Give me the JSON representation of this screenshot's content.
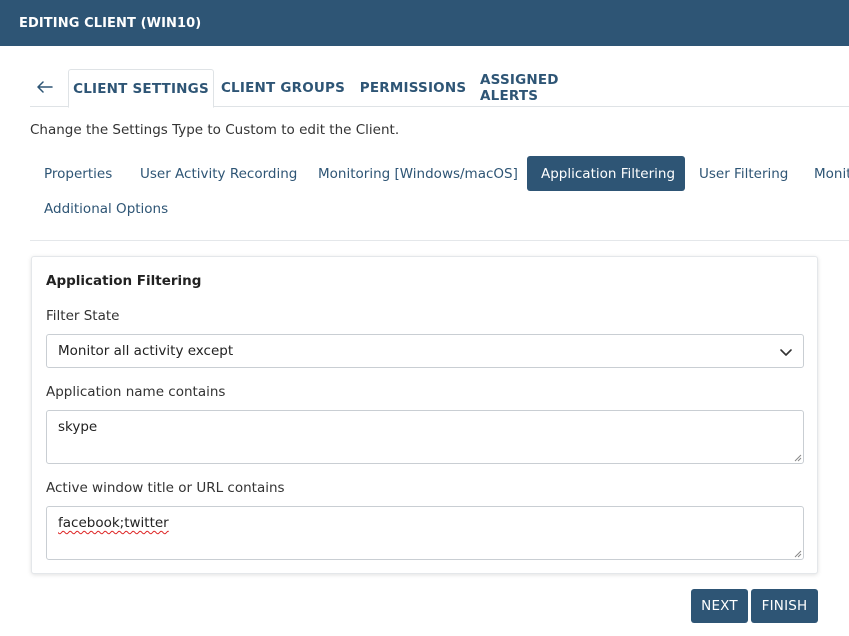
{
  "window": {
    "title": "EDITING CLIENT (WIN10)"
  },
  "tabs": {
    "back_icon": "arrow-left-icon",
    "items": [
      {
        "label": "CLIENT SETTINGS",
        "active": true
      },
      {
        "label": "CLIENT GROUPS",
        "active": false
      },
      {
        "label": "PERMISSIONS",
        "active": false
      },
      {
        "label": "ASSIGNED ALERTS",
        "active": false
      }
    ]
  },
  "hint": "Change the Settings Type to Custom to edit the Client.",
  "subtabs": {
    "items": [
      {
        "label": "Properties",
        "active": false
      },
      {
        "label": "User Activity Recording",
        "active": false
      },
      {
        "label": "Monitoring [Windows/macOS]",
        "active": false
      },
      {
        "label": "Application Filtering",
        "active": true
      },
      {
        "label": "User Filtering",
        "active": false
      },
      {
        "label": "Monit",
        "active": false
      },
      {
        "label": "Additional Options",
        "active": false
      }
    ]
  },
  "form": {
    "title": "Application Filtering",
    "filter_state": {
      "label": "Filter State",
      "value": "Monitor all activity except",
      "icon": "chevron-down-icon"
    },
    "app_name": {
      "label": "Application name contains",
      "value": "skype"
    },
    "window_title": {
      "label": "Active window title or URL contains",
      "value": "facebook;twitter"
    }
  },
  "buttons": {
    "next": "NEXT",
    "finish": "FINISH"
  },
  "colors": {
    "primary": "#2e5575",
    "border": "#c9ced3",
    "text": "#333333"
  }
}
